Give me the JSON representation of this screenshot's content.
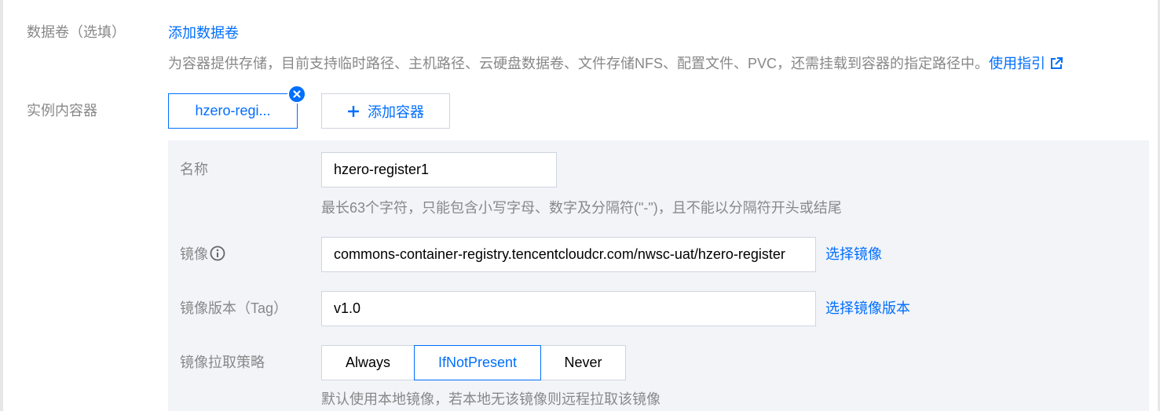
{
  "volumes": {
    "label": "数据卷（选填）",
    "add_link": "添加数据卷",
    "hint": "为容器提供存储，目前支持临时路径、主机路径、云硬盘数据卷、文件存储NFS、配置文件、PVC，还需挂载到容器的指定路径中。",
    "guide_link": "使用指引",
    "guide_icon": "external-link-icon"
  },
  "containers": {
    "label": "实例内容器",
    "tabs": [
      {
        "label": "hzero-regi..."
      }
    ],
    "add_button": "添加容器",
    "add_icon": "plus-icon",
    "close_icon": "close-icon"
  },
  "form": {
    "name": {
      "label": "名称",
      "value": "hzero-register1",
      "hint": "最长63个字符，只能包含小写字母、数字及分隔符(\"-\")，且不能以分隔符开头或结尾"
    },
    "image": {
      "label": "镜像",
      "info_icon": "info-icon",
      "value": "commons-container-registry.tencentcloudcr.com/nwsc-uat/hzero-register",
      "select_link": "选择镜像"
    },
    "image_tag": {
      "label": "镜像版本（Tag）",
      "value": "v1.0",
      "select_link": "选择镜像版本"
    },
    "pull_policy": {
      "label": "镜像拉取策略",
      "options": [
        "Always",
        "IfNotPresent",
        "Never"
      ],
      "selected": "IfNotPresent",
      "hint": "默认使用本地镜像，若本地无该镜像则远程拉取该镜像"
    }
  },
  "colors": {
    "accent": "#006eff",
    "label_gray": "#888888",
    "panel_bg": "#f2f4f8",
    "border": "#cfd5de"
  }
}
